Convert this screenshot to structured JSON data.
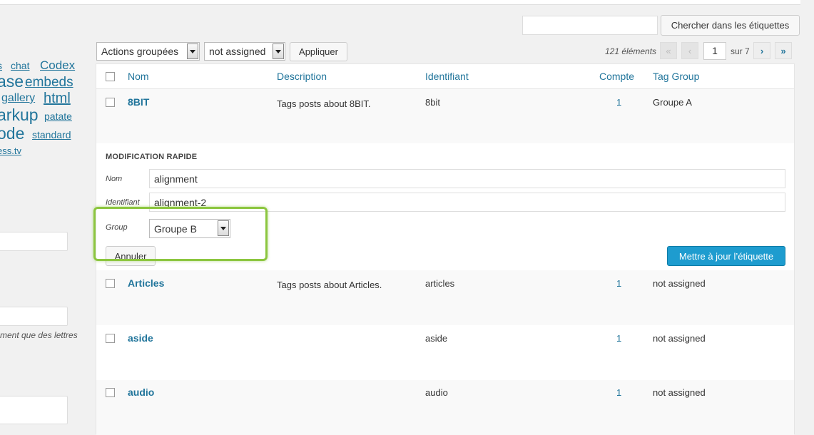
{
  "tag_cloud": [
    "s",
    "chat",
    "Codex",
    "ase",
    "embeds",
    "gallery",
    "html",
    "arkup",
    "patate",
    "ode",
    "standard",
    "ess.tv"
  ],
  "left_hint": "ment que des lettres",
  "search": {
    "button_label": "Chercher dans les étiquettes",
    "value": ""
  },
  "bulk": {
    "actions_selected": "Actions groupées",
    "group_selected": "not assigned",
    "apply_label": "Appliquer"
  },
  "pagination": {
    "count": "121 éléments",
    "first": "«",
    "prev": "‹",
    "current_page": "1",
    "of": "sur 7",
    "next": "›",
    "last": "»"
  },
  "table": {
    "headers": {
      "name": "Nom",
      "description": "Description",
      "slug": "Identifiant",
      "count": "Compte",
      "group": "Tag Group"
    },
    "rows": [
      {
        "name": "8BIT",
        "description": "Tags posts about 8BIT.",
        "slug": "8bit",
        "count": "1",
        "group": "Groupe A"
      },
      {
        "name": "Articles",
        "description": "Tags posts about Articles.",
        "slug": "articles",
        "count": "1",
        "group": "not assigned"
      },
      {
        "name": "aside",
        "description": "",
        "slug": "aside",
        "count": "1",
        "group": "not assigned"
      },
      {
        "name": "audio",
        "description": "",
        "slug": "audio",
        "count": "1",
        "group": "not assigned"
      }
    ]
  },
  "quick_edit": {
    "title": "MODIFICATION RAPIDE",
    "name_label": "Nom",
    "name_value": "alignment",
    "slug_label": "Identifiant",
    "slug_value": "alignment-2",
    "group_label": "Group",
    "group_value": "Groupe B",
    "cancel_label": "Annuler",
    "update_label": "Mettre à jour l’étiquette"
  },
  "colors": {
    "link": "#21759b",
    "primary": "#1e9ccf",
    "highlight": "#8cc63f"
  }
}
